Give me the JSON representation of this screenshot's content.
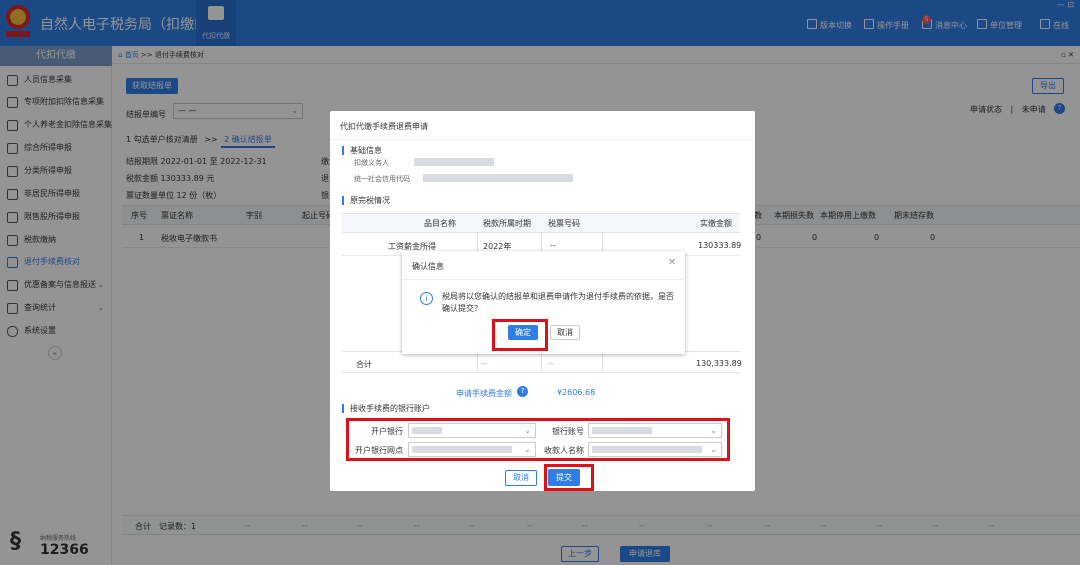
{
  "header": {
    "title": "自然人电子税务局（扣缴端）",
    "top_nav_label": "代扣代缴",
    "buttons": [
      {
        "label": "版本切换",
        "icon": "version-icon"
      },
      {
        "label": "操作手册",
        "icon": "manual-icon"
      },
      {
        "label": "消息中心",
        "icon": "message-icon",
        "badge": "5"
      },
      {
        "label": "单位管理",
        "icon": "unit-icon"
      },
      {
        "label": "在线",
        "icon": "online-icon"
      }
    ],
    "window_controls": "— ⊡"
  },
  "sidebar": {
    "title": "代扣代缴",
    "items": [
      {
        "label": "人员信息采集"
      },
      {
        "label": "专项附加扣除信息采集"
      },
      {
        "label": "个人养老金扣除信息采集"
      },
      {
        "label": "综合所得申报"
      },
      {
        "label": "分类所得申报"
      },
      {
        "label": "非居民所得申报"
      },
      {
        "label": "限售股所得申报"
      },
      {
        "label": "税款缴纳"
      },
      {
        "label": "退付手续费核对"
      },
      {
        "label": "优惠备案与信息报送",
        "chevron": "⌄"
      },
      {
        "label": "查询统计",
        "chevron": "⌄"
      },
      {
        "label": "系统设置"
      }
    ],
    "collapse": "«",
    "hotline_label": "纳税服务热线",
    "hotline_number": "12366"
  },
  "breadcrumb": {
    "home": "首页",
    "sep": ">>",
    "current": "退付手续费核对",
    "close": "▫ ✕"
  },
  "toolbar": {
    "fetch_label": "获取结报单",
    "export_label": "导出"
  },
  "filter": {
    "report_no_label": "结报单编号",
    "report_no_value": "— —",
    "status_label": "申请状态",
    "status_sep": "|",
    "status_value": "未申请"
  },
  "steps": {
    "step1": "1 勾选单户核对清册",
    "arrow": ">>",
    "step2": "2 确认结报单"
  },
  "info": {
    "period_label": "结报期限",
    "period_start": "2022-01-01",
    "period_to": "至",
    "period_end": "2022-12-31",
    "tax_amount_label": "税款金额",
    "tax_amount_value": "130333.89 元",
    "ticket_qty_label": "票证数量单位",
    "ticket_qty_value": "12 份（枚）",
    "partial_1": "缴",
    "partial_2": "退",
    "partial_3": "银"
  },
  "main_table": {
    "headers": [
      "序号",
      "票证名称",
      "字别",
      "起止号码",
      "数",
      "本期损失数",
      "本期停用上缴数",
      "期末结存数"
    ],
    "row": {
      "index": "1",
      "name": "税收电子缴款书",
      "c5": "0",
      "c6": "0",
      "c7": "0",
      "c8": "0"
    },
    "total_label": "合计",
    "total_count": "记录数：1",
    "dash": "--"
  },
  "footer": {
    "prev_label": "上一步",
    "apply_label": "申请退库"
  },
  "dialog": {
    "title": "代扣代缴手续费退费申请",
    "basic_info_title": "基础信息",
    "withholder_label": "扣缴义务人",
    "credit_code_label": "统一社会信用代码",
    "tax_detail_title": "原完税情况",
    "table_headers": [
      "品目名称",
      "税款所属时期",
      "税票号码",
      "实缴金额"
    ],
    "row": {
      "item": "工资薪金所得",
      "period": "2022年",
      "ticket": "--",
      "amount": "130333.89"
    },
    "total_label": "合计",
    "total_dash1": "--",
    "total_dash2": "--",
    "total_amount": "130,333.89",
    "fee_label": "申请手续费金额",
    "fee_value": "¥2606.68",
    "bank_title": "接收手续费的银行账户",
    "bank_label": "开户银行",
    "account_label": "银行账号",
    "branch_label": "开户银行网点",
    "payee_label": "收款人名称",
    "cancel_label": "取消",
    "submit_label": "提交"
  },
  "confirm": {
    "title": "确认信息",
    "message": "税局将以您确认的结报单和退费申请作为退付手续费的依据，是否确认提交？",
    "ok_label": "确定",
    "cancel_label": "取消",
    "close": "✕",
    "info_glyph": "i"
  }
}
